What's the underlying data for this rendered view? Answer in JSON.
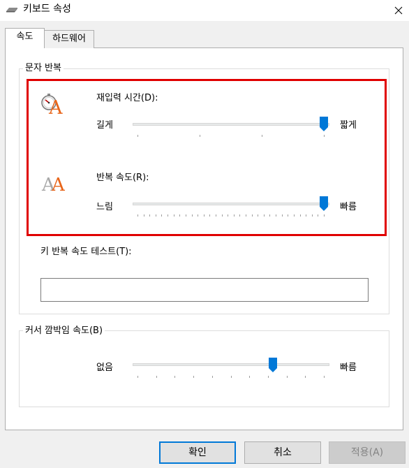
{
  "window": {
    "title": "키보드 속성"
  },
  "tabs": [
    {
      "label": "속도",
      "active": true
    },
    {
      "label": "하드웨어",
      "active": false
    }
  ],
  "repeat_group": {
    "title": "문자 반복",
    "delay": {
      "label": "재입력 시간(D):",
      "left_label": "길게",
      "right_label": "짧게",
      "value": 3,
      "min": 0,
      "max": 3
    },
    "rate": {
      "label": "반복 속도(R):",
      "left_label": "느림",
      "right_label": "빠름",
      "value": 31,
      "min": 0,
      "max": 31
    },
    "test_label": "키 반복 속도 테스트(T):",
    "test_value": ""
  },
  "cursor_group": {
    "title": "커서 깜박임 속도(B)",
    "left_label": "없음",
    "right_label": "빠름",
    "value": 0.73
  },
  "buttons": {
    "ok": "확인",
    "cancel": "취소",
    "apply": "적용(A)"
  },
  "colors": {
    "highlight": "#e00000",
    "thumb": "#0078d7",
    "default_button_border": "#0078d7"
  },
  "icons": {
    "window": "keyboard-icon",
    "delay": "stopwatch-a-icon",
    "rate": "double-a-icon",
    "close": "close-icon"
  }
}
